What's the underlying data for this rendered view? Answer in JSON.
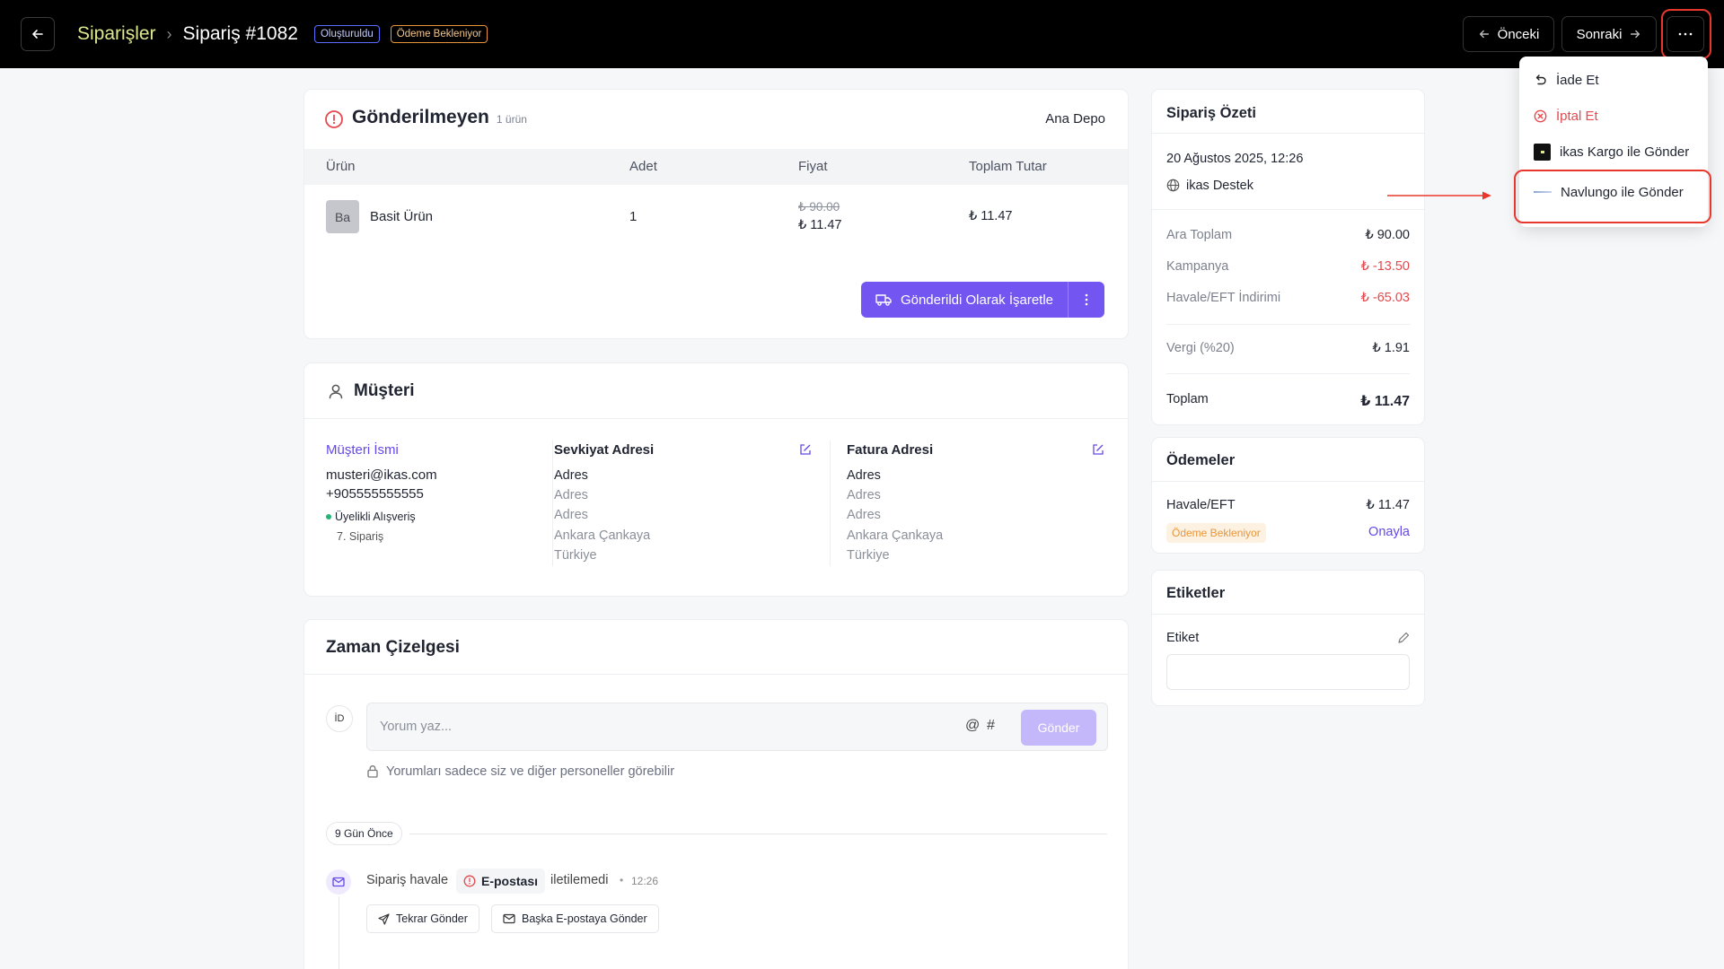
{
  "header": {
    "breadcrumb_parent": "Siparişler",
    "order_title": "Sipariş #1082",
    "badge_created": "Oluşturuldu",
    "badge_payment": "Ödeme Bekleniyor",
    "prev_label": "Önceki",
    "next_label": "Sonraki"
  },
  "menu": {
    "items": [
      {
        "label": "İade Et",
        "icon": "undo-icon"
      },
      {
        "label": "İptal Et",
        "icon": "cancel-circle-icon"
      },
      {
        "label": "ikas Kargo ile Gönder",
        "icon": "ikas-cargo-logo"
      },
      {
        "label": "Navlungo ile Gönder",
        "icon": "navlungo-logo"
      }
    ]
  },
  "unsent": {
    "title": "Gönderilmeyen",
    "count": "1 ürün",
    "warehouse": "Ana Depo",
    "columns": [
      "Ürün",
      "Adet",
      "Fiyat",
      "Toplam Tutar"
    ],
    "item": {
      "thumb": "Ba",
      "name": "Basit Ürün",
      "qty": "1",
      "old_price": "₺ 90.00",
      "price": "₺ 11.47",
      "total": "₺ 11.47"
    },
    "mark_sent_label": "Gönderildi Olarak İşaretle"
  },
  "customer": {
    "title": "Müşteri",
    "name": "Müşteri İsmi",
    "email": "musteri@ikas.com",
    "phone": "+905555555555",
    "membership": "Üyelikli Alışveriş",
    "order_count": "7. Sipariş",
    "shipping": {
      "title": "Sevkiyat Adresi",
      "lines": [
        "Adres",
        "Adres",
        "Adres",
        "Ankara Çankaya",
        "Türkiye"
      ]
    },
    "billing": {
      "title": "Fatura Adresi",
      "lines": [
        "Adres",
        "Adres",
        "Adres",
        "Ankara Çankaya",
        "Türkiye"
      ]
    }
  },
  "timeline": {
    "title": "Zaman Çizelgesi",
    "avatar": "İD",
    "comment_placeholder": "Yorum yaz...",
    "at_symbol": "@",
    "hash_symbol": "#",
    "send_label": "Gönder",
    "privacy_note": "Yorumları sadece siz ve diğer personeller görebilir",
    "date_pill": "9 Gün Önce",
    "event_prefix": "Sipariş havale",
    "event_tag": "E-postası",
    "event_suffix": "iletilemedi",
    "event_dot": "•",
    "event_time": "12:26",
    "resend_label": "Tekrar Gönder",
    "other_email_label": "Başka E-postaya Gönder"
  },
  "summary": {
    "title": "Sipariş Özeti",
    "date": "20 Ağustos 2025, 12:26",
    "channel": "ikas Destek",
    "rows": [
      {
        "k": "Ara Toplam",
        "v": "₺ 90.00"
      },
      {
        "k": "Kampanya",
        "v": "₺ -13.50"
      },
      {
        "k": "Havale/EFT İndirimi",
        "v": "₺ -65.03"
      },
      {
        "k": "Vergi (%20)",
        "v": "₺ 1.91"
      },
      {
        "k": "Toplam",
        "v": "₺ 11.47"
      }
    ]
  },
  "payments": {
    "title": "Ödemeler",
    "method": "Havale/EFT",
    "amount": "₺ 11.47",
    "status": "Ödeme Bekleniyor",
    "approve_label": "Onayla"
  },
  "tags": {
    "title": "Etiketler",
    "label": "Etiket"
  },
  "colors": {
    "accent": "#7356f2",
    "danger": "#e5484d",
    "highlight": "#e8382d"
  }
}
